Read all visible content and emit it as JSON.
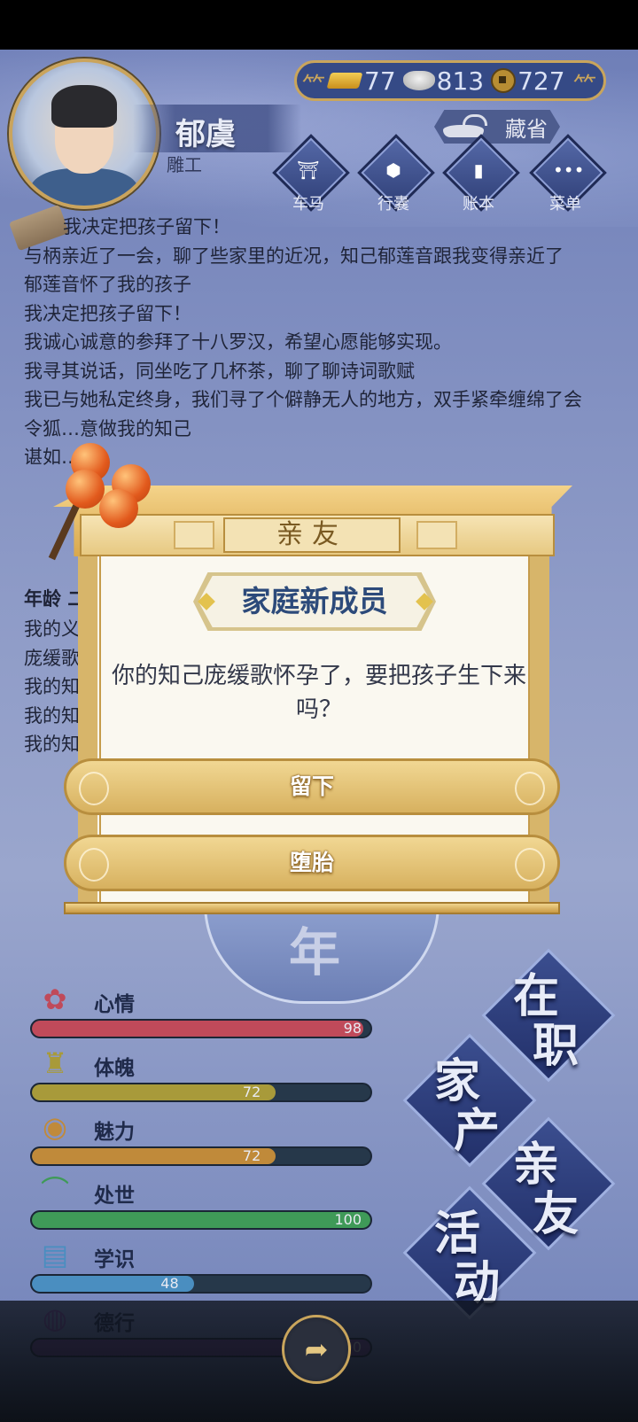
{
  "player": {
    "name": "郁虞",
    "title": "雕工"
  },
  "currency": {
    "gold": "77",
    "silver": "813",
    "coin": "727"
  },
  "hide_button": {
    "label": "藏省"
  },
  "menu": [
    {
      "label": "车马",
      "icon": "carriage-icon"
    },
    {
      "label": "行囊",
      "icon": "bag-icon"
    },
    {
      "label": "账本",
      "icon": "ledger-icon"
    },
    {
      "label": "菜单",
      "icon": "more-icon"
    }
  ],
  "log_lines": [
    "我决定把孩子留下！",
    "与柄亲近了一会，聊了些家里的近况，知己郁莲音跟我变得亲近了",
    "郁莲音怀了我的孩子",
    "我决定把孩子留下！",
    "我诚心诚意的参拜了十八罗汉，希望心愿能够实现。",
    "我寻其说话，同坐吃了几杯茶，聊了聊诗词歌赋",
    "我已与她私定终身，我们寻了个僻静无人的地方，双手紧牵缠绵了会",
    "令狐…意做我的知己",
    "谌如…"
  ],
  "log_section": {
    "heading": "年龄 二",
    "lines": [
      "我的义",
      "庞缓歌",
      "我的知",
      "我的知",
      "我的知"
    ]
  },
  "year_label": "年",
  "stats": [
    {
      "label": "心情",
      "value": 98,
      "max": 100,
      "color": "#c04a5a",
      "icon": "flower-icon"
    },
    {
      "label": "体魄",
      "value": 72,
      "max": 100,
      "color": "#a89a3a",
      "icon": "lantern-icon"
    },
    {
      "label": "魅力",
      "value": 72,
      "max": 100,
      "color": "#c08a3a",
      "icon": "jade-icon"
    },
    {
      "label": "处世",
      "value": 100,
      "max": 100,
      "color": "#3f9a58",
      "icon": "hat-icon"
    },
    {
      "label": "学识",
      "value": 48,
      "max": 100,
      "color": "#4a8ec0",
      "icon": "books-icon"
    },
    {
      "label": "德行",
      "value": 100,
      "max": 100,
      "color": "#7a4aa0",
      "icon": "medal-icon"
    }
  ],
  "stat_visible_numbers": [
    "98",
    "72",
    "72",
    "100",
    "48",
    "100"
  ],
  "tiles": [
    {
      "label": "在职",
      "chars": [
        "在",
        "职"
      ]
    },
    {
      "label": "家产",
      "chars": [
        "家",
        "产"
      ]
    },
    {
      "label": "亲友",
      "chars": [
        "亲",
        "友"
      ]
    },
    {
      "label": "活动",
      "chars": [
        "活",
        "动"
      ]
    }
  ],
  "dialog": {
    "tab_label": "亲友",
    "title": "家庭新成员",
    "message": "你的知己庞缓歌怀孕了，要把孩子生下来吗？",
    "choices": [
      {
        "label": "留下"
      },
      {
        "label": "堕胎"
      }
    ]
  },
  "colors": {
    "accent_gold": "#c9a55c",
    "title_blue": "#2c4a7a",
    "panel_cream": "#faf8f0"
  }
}
